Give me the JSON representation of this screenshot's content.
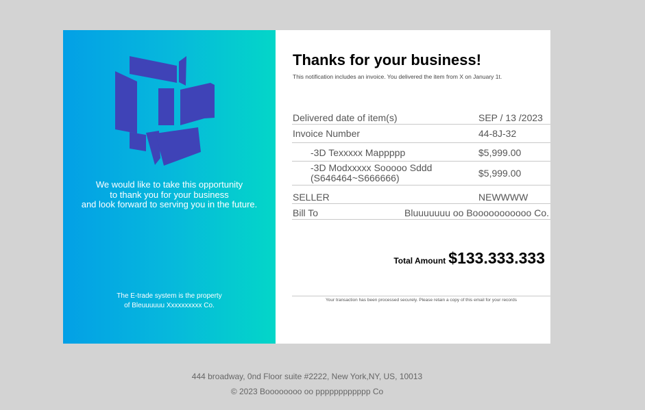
{
  "left_panel": {
    "message_lines": [
      "We would like to take this opportunity",
      "to thank you for your business",
      "and look forward to serving you in the future."
    ],
    "footer_lines": [
      "The E-trade system is the property",
      "of Bleuuuuuu Xxxxxxxxxx Co."
    ],
    "logo_icon": "cube-logo-icon",
    "logo_color": "#3f43b7"
  },
  "invoice": {
    "title": "Thanks for your business!",
    "subtitle": "This notification includes an invoice. You delivered the item from X on January 1t.",
    "rows": {
      "delivered": {
        "label": "Delivered date of item(s)",
        "value": "SEP / 13 /2023"
      },
      "invoice_number": {
        "label": "Invoice Number",
        "value": "44-8J-32"
      },
      "item1": {
        "label": "-3D Texxxxx Mappppp",
        "value": "$5,999.00"
      },
      "item2": {
        "label_line1": "-3D Modxxxxx Sooooo Sddd",
        "label_line2": "(S646464~S666666)",
        "value": "$5,999.00"
      },
      "seller": {
        "label": "SELLER",
        "value": "NEWWWW"
      },
      "bill_to": {
        "label": "Bill To",
        "value": "Bluuuuuuu oo Booooooooooo Co."
      }
    },
    "total": {
      "label": "Total Amount",
      "value": "$133.333.333"
    },
    "secure_note": "Your transaction has been processed securely. Please retain a copy of this email for your records"
  },
  "footer": {
    "address": "444 broadway, 0nd Floor suite #2222, New York,NY, US, 10013",
    "copyright": "© 2023 Boooooooo oo pppppppppppp Co"
  },
  "colors": {
    "gradient_start": "#03a0e6",
    "gradient_end": "#04d6c8",
    "background": "#d3d3d3"
  }
}
